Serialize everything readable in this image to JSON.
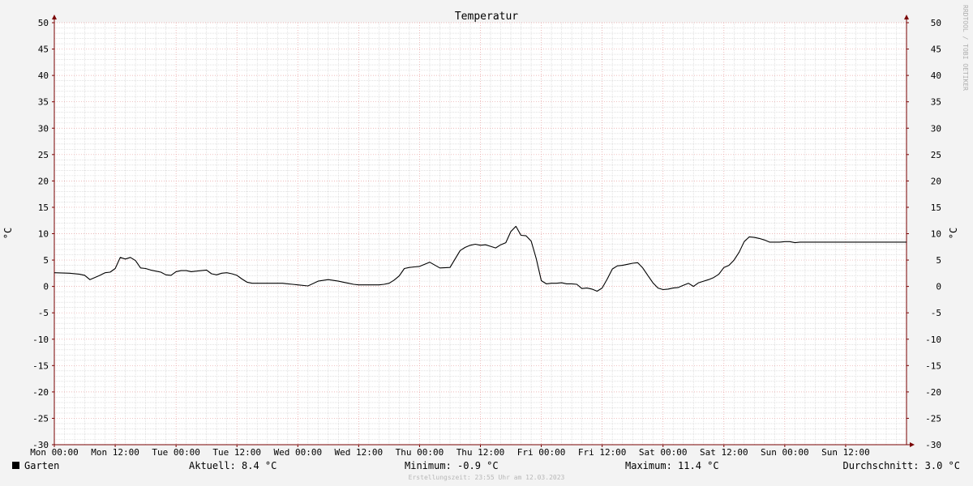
{
  "chart_data": {
    "type": "line",
    "title": "Temperatur",
    "ylabel": "°C",
    "ylim": [
      -30,
      50
    ],
    "y_ticks": [
      50,
      45,
      40,
      35,
      30,
      25,
      20,
      15,
      10,
      5,
      0,
      -5,
      -10,
      -15,
      -20,
      -25,
      -30
    ],
    "x_range_hours": [
      0,
      168
    ],
    "x_tick_hours": [
      0,
      12,
      24,
      36,
      48,
      60,
      72,
      84,
      96,
      108,
      120,
      132,
      144,
      156
    ],
    "x_tick_labels": [
      "Mon 00:00",
      "Mon 12:00",
      "Tue 00:00",
      "Tue 12:00",
      "Wed 00:00",
      "Wed 12:00",
      "Thu 00:00",
      "Thu 12:00",
      "Fri 00:00",
      "Fri 12:00",
      "Sat 00:00",
      "Sat 12:00",
      "Sun 00:00",
      "Sun 12:00"
    ],
    "grid": true,
    "series": [
      {
        "name": "Garten",
        "color": "#000000",
        "x": [
          0,
          3,
          5,
          6,
          7,
          8,
          9,
          10,
          11,
          12,
          13,
          14,
          15,
          16,
          17,
          18,
          19,
          20,
          21,
          22,
          23,
          24,
          25,
          26,
          27,
          28,
          29,
          30,
          31,
          32,
          33,
          34,
          35,
          36,
          37,
          38,
          39,
          40,
          41,
          42,
          43,
          44,
          45,
          46,
          47,
          48,
          50,
          52,
          54,
          56,
          57,
          58,
          59,
          60,
          61,
          62,
          63,
          64,
          65,
          66,
          67,
          68,
          69,
          70,
          71,
          72,
          74,
          76,
          78,
          80,
          81,
          82,
          83,
          84,
          85,
          86,
          87,
          88,
          89,
          90,
          91,
          92,
          93,
          94,
          95,
          96,
          97,
          98,
          99,
          100,
          101,
          102,
          103,
          104,
          105,
          106,
          107,
          108,
          109,
          110,
          111,
          112,
          113,
          114,
          115,
          116,
          117,
          118,
          119,
          120,
          121,
          122,
          123,
          124,
          125,
          126,
          127,
          128,
          129,
          130,
          131,
          132,
          133,
          134,
          135,
          136,
          137,
          138,
          139,
          140,
          141,
          142,
          143,
          144,
          145,
          146,
          147,
          148,
          149,
          150,
          151,
          152,
          153,
          154,
          155,
          156,
          157,
          158,
          159,
          160,
          161,
          162,
          163,
          164,
          165,
          166,
          167,
          168
        ],
        "values": [
          2.6,
          2.5,
          2.3,
          2.1,
          1.3,
          1.7,
          2.1,
          2.6,
          2.7,
          3.4,
          5.5,
          5.2,
          5.5,
          4.9,
          3.5,
          3.4,
          3.1,
          2.9,
          2.7,
          2.2,
          2.1,
          2.8,
          3.0,
          3.0,
          2.8,
          2.9,
          3.0,
          3.1,
          2.4,
          2.2,
          2.5,
          2.6,
          2.4,
          2.1,
          1.4,
          0.8,
          0.6,
          0.6,
          0.6,
          0.6,
          0.6,
          0.6,
          0.6,
          0.5,
          0.4,
          0.3,
          0.1,
          1.0,
          1.3,
          1.0,
          0.8,
          0.6,
          0.4,
          0.3,
          0.3,
          0.3,
          0.3,
          0.3,
          0.4,
          0.6,
          1.2,
          2.0,
          3.4,
          3.6,
          3.7,
          3.8,
          4.6,
          3.5,
          3.6,
          6.8,
          7.4,
          7.8,
          8.0,
          7.8,
          7.9,
          7.6,
          7.3,
          7.9,
          8.3,
          10.4,
          11.4,
          9.7,
          9.6,
          8.6,
          5.3,
          1.1,
          0.5,
          0.6,
          0.6,
          0.7,
          0.5,
          0.5,
          0.4,
          -0.4,
          -0.3,
          -0.5,
          -0.9,
          -0.3,
          1.4,
          3.3,
          3.9,
          4.0,
          4.2,
          4.4,
          4.5,
          3.5,
          2.1,
          0.7,
          -0.3,
          -0.6,
          -0.5,
          -0.3,
          -0.2,
          0.2,
          0.6,
          0.0,
          0.7,
          1.0,
          1.3,
          1.7,
          2.3,
          3.6,
          4.0,
          5.0,
          6.5,
          8.5,
          9.4,
          9.3,
          9.1,
          8.8,
          8.4,
          8.4,
          8.4,
          8.5,
          8.5,
          8.3,
          8.4,
          8.4,
          8.4,
          8.4,
          8.4,
          8.4,
          8.4,
          8.4,
          8.4,
          8.4,
          8.4,
          8.4,
          8.4,
          8.4,
          8.4,
          8.4,
          8.4,
          8.4,
          8.4,
          8.4,
          8.4,
          8.4
        ]
      }
    ],
    "legend_position": "bottom-left"
  },
  "legend": {
    "series_name": "Garten",
    "series_color": "#000000"
  },
  "stats": {
    "current": "Aktuell: 8.4 °C",
    "minimum": "Minimum: -0.9 °C",
    "maximum": "Maximum: 11.4 °C",
    "average": "Durchschnitt: 3.0 °C"
  },
  "footer": {
    "created": "Erstellungszeit: 23:55 Uhr am 12.03.2023"
  },
  "watermark": "RRDTOOL / TOBI OETIKER",
  "colors": {
    "background": "#f3f3f3",
    "plot_background": "#ffffff",
    "major_grid": "#e8a0a0",
    "minor_grid": "#cfcfcf",
    "axis": "#7a0000"
  }
}
